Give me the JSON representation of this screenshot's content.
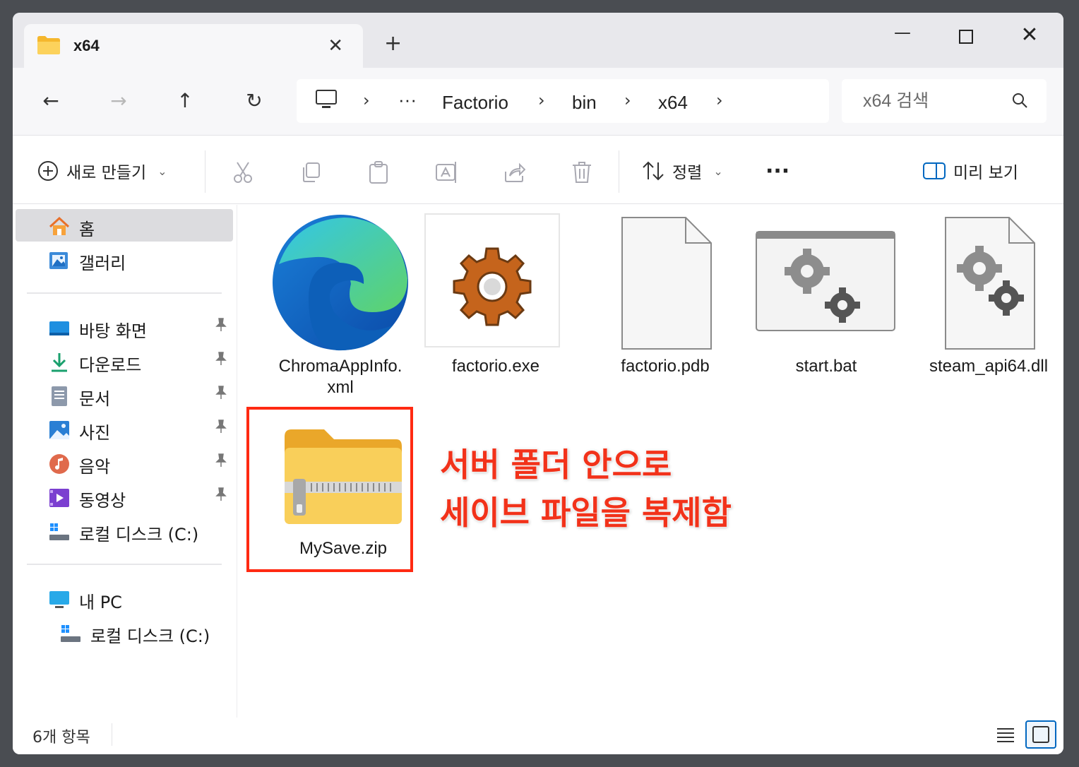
{
  "tab": {
    "title": "x64",
    "close": "✕",
    "new": "+"
  },
  "window_controls": {
    "minimize": "—",
    "close": "✕"
  },
  "nav": {
    "back": "←",
    "forward": "→",
    "up": "↑",
    "refresh": "↻"
  },
  "breadcrumb": {
    "ellipsis": "···",
    "separator": "›",
    "items": [
      "Factorio",
      "bin",
      "x64"
    ]
  },
  "search": {
    "placeholder": "x64 검색"
  },
  "commandbar": {
    "new_label": "새로 만들기",
    "sort_label": "정렬",
    "more": "···",
    "preview_label": "미리 보기",
    "chevron": "⌄"
  },
  "sidebar": {
    "quick": [
      {
        "label": "홈",
        "icon": "home-icon"
      },
      {
        "label": "갤러리",
        "icon": "gallery-icon"
      }
    ],
    "pinned": [
      {
        "label": "바탕 화면",
        "icon": "desktop-icon"
      },
      {
        "label": "다운로드",
        "icon": "download-icon"
      },
      {
        "label": "문서",
        "icon": "document-icon"
      },
      {
        "label": "사진",
        "icon": "pictures-icon"
      },
      {
        "label": "음악",
        "icon": "music-icon"
      },
      {
        "label": "동영상",
        "icon": "video-icon"
      },
      {
        "label": "로컬 디스크 (C:)",
        "icon": "drive-icon"
      }
    ],
    "pc": [
      {
        "label": "내 PC",
        "icon": "pc-icon"
      },
      {
        "label": "로컬 디스크 (C:)",
        "icon": "drive-icon"
      }
    ],
    "pin_glyph": "📌"
  },
  "files": [
    {
      "name": "ChromaAppInfo.\nxml",
      "name_line1": "ChromaAppInfo.",
      "name_line2": "xml",
      "icon": "edge-icon"
    },
    {
      "name": "factorio.exe",
      "icon": "gear-app-icon"
    },
    {
      "name": "factorio.pdb",
      "icon": "blank-file-icon"
    },
    {
      "name": "start.bat",
      "icon": "batch-file-icon"
    },
    {
      "name": "steam_api64.dll",
      "icon": "dll-file-icon"
    },
    {
      "name": "MySave.zip",
      "icon": "zip-folder-icon"
    }
  ],
  "annotation": {
    "line1": "서버 폴더 안으로",
    "line2": "세이브 파일을 복제함",
    "color": "#f2321a"
  },
  "status": {
    "count": "6개 항목"
  },
  "colors": {
    "accent": "#0067c0",
    "highlight": "#ff2a12",
    "folder": "#f7c948"
  }
}
